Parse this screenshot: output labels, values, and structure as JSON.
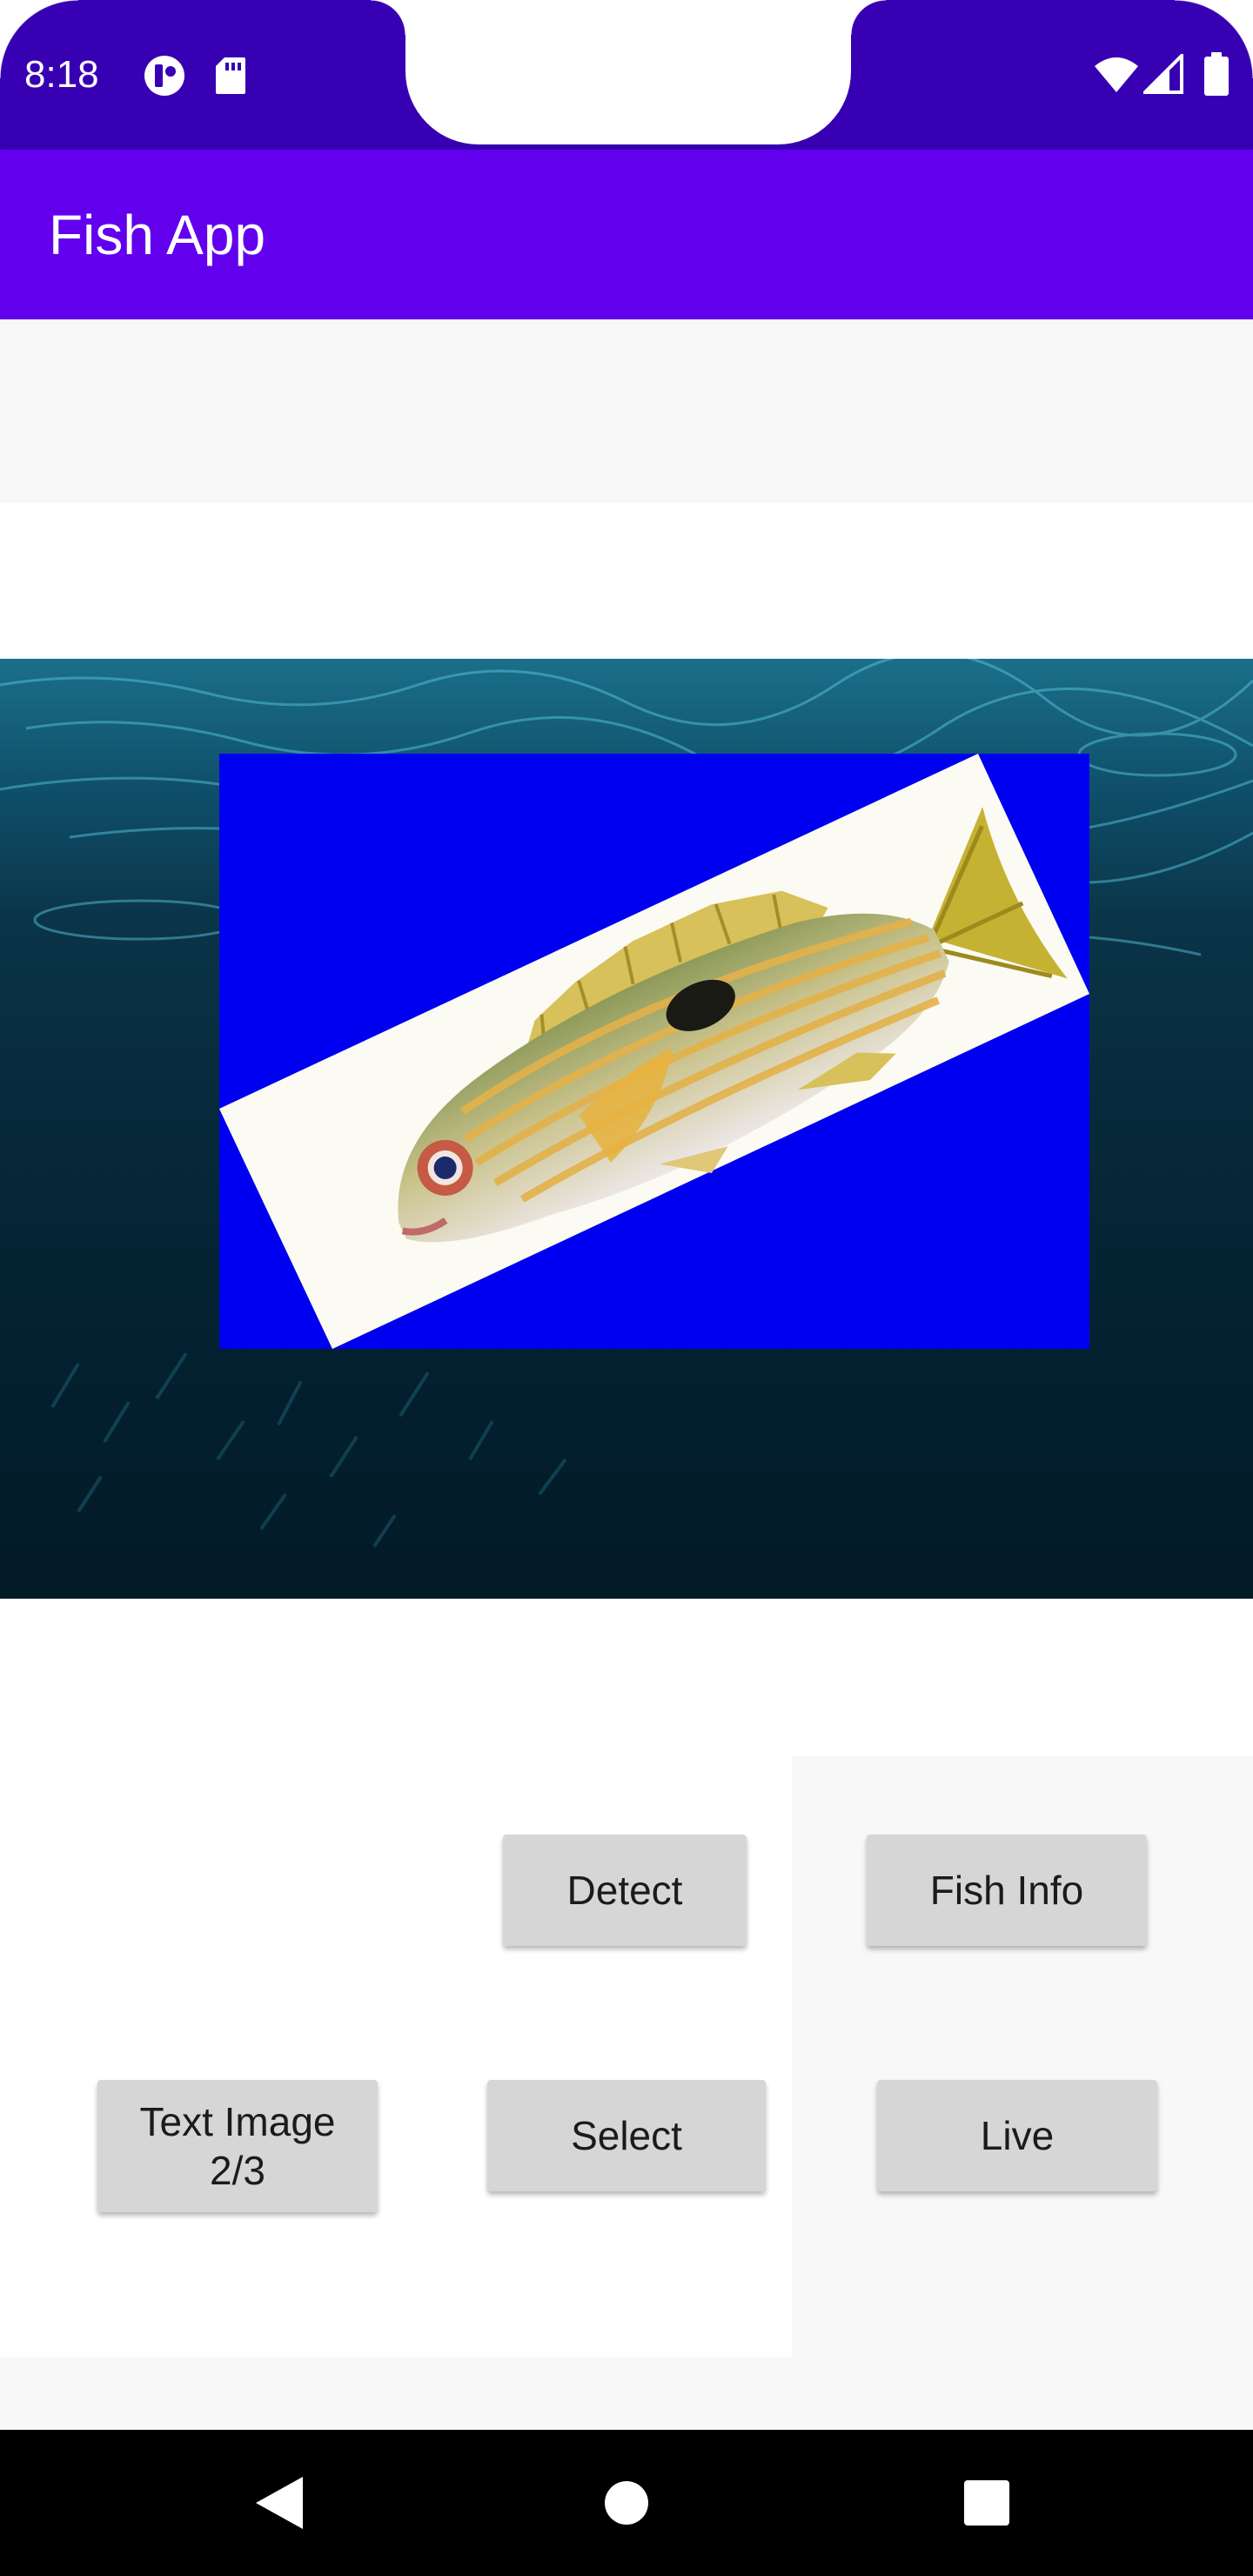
{
  "status_bar": {
    "time": "8:18",
    "icons": [
      "notification-app-icon",
      "sd-card-icon",
      "wifi-icon",
      "signal-icon",
      "battery-icon"
    ]
  },
  "app_bar": {
    "title": "Fish App"
  },
  "image": {
    "subject": "striped yellow fish",
    "background_color": "#0000f0"
  },
  "buttons": {
    "detect": "Detect",
    "fish_info": "Fish Info",
    "text_image": "Text Image 2/3",
    "select": "Select",
    "live": "Live"
  },
  "nav_bar": {
    "icons": [
      "back-icon",
      "home-icon",
      "recents-icon"
    ]
  },
  "colors": {
    "status_bar": "#3700b3",
    "app_bar": "#6200ee",
    "button": "#d6d6d6",
    "fish_background": "#0000f0"
  }
}
